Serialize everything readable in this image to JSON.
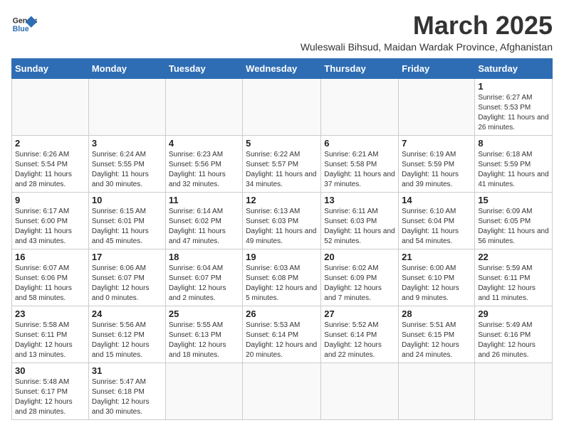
{
  "header": {
    "logo_general": "General",
    "logo_blue": "Blue",
    "month_title": "March 2025",
    "subtitle": "Wuleswali Bihsud, Maidan Wardak Province, Afghanistan"
  },
  "weekdays": [
    "Sunday",
    "Monday",
    "Tuesday",
    "Wednesday",
    "Thursday",
    "Friday",
    "Saturday"
  ],
  "weeks": [
    [
      {
        "num": "",
        "info": ""
      },
      {
        "num": "",
        "info": ""
      },
      {
        "num": "",
        "info": ""
      },
      {
        "num": "",
        "info": ""
      },
      {
        "num": "",
        "info": ""
      },
      {
        "num": "",
        "info": ""
      },
      {
        "num": "1",
        "info": "Sunrise: 6:27 AM\nSunset: 5:53 PM\nDaylight: 11 hours\nand 26 minutes."
      }
    ],
    [
      {
        "num": "2",
        "info": "Sunrise: 6:26 AM\nSunset: 5:54 PM\nDaylight: 11 hours\nand 28 minutes."
      },
      {
        "num": "3",
        "info": "Sunrise: 6:24 AM\nSunset: 5:55 PM\nDaylight: 11 hours\nand 30 minutes."
      },
      {
        "num": "4",
        "info": "Sunrise: 6:23 AM\nSunset: 5:56 PM\nDaylight: 11 hours\nand 32 minutes."
      },
      {
        "num": "5",
        "info": "Sunrise: 6:22 AM\nSunset: 5:57 PM\nDaylight: 11 hours\nand 34 minutes."
      },
      {
        "num": "6",
        "info": "Sunrise: 6:21 AM\nSunset: 5:58 PM\nDaylight: 11 hours\nand 37 minutes."
      },
      {
        "num": "7",
        "info": "Sunrise: 6:19 AM\nSunset: 5:59 PM\nDaylight: 11 hours\nand 39 minutes."
      },
      {
        "num": "8",
        "info": "Sunrise: 6:18 AM\nSunset: 5:59 PM\nDaylight: 11 hours\nand 41 minutes."
      }
    ],
    [
      {
        "num": "9",
        "info": "Sunrise: 6:17 AM\nSunset: 6:00 PM\nDaylight: 11 hours\nand 43 minutes."
      },
      {
        "num": "10",
        "info": "Sunrise: 6:15 AM\nSunset: 6:01 PM\nDaylight: 11 hours\nand 45 minutes."
      },
      {
        "num": "11",
        "info": "Sunrise: 6:14 AM\nSunset: 6:02 PM\nDaylight: 11 hours\nand 47 minutes."
      },
      {
        "num": "12",
        "info": "Sunrise: 6:13 AM\nSunset: 6:03 PM\nDaylight: 11 hours\nand 49 minutes."
      },
      {
        "num": "13",
        "info": "Sunrise: 6:11 AM\nSunset: 6:03 PM\nDaylight: 11 hours\nand 52 minutes."
      },
      {
        "num": "14",
        "info": "Sunrise: 6:10 AM\nSunset: 6:04 PM\nDaylight: 11 hours\nand 54 minutes."
      },
      {
        "num": "15",
        "info": "Sunrise: 6:09 AM\nSunset: 6:05 PM\nDaylight: 11 hours\nand 56 minutes."
      }
    ],
    [
      {
        "num": "16",
        "info": "Sunrise: 6:07 AM\nSunset: 6:06 PM\nDaylight: 11 hours\nand 58 minutes."
      },
      {
        "num": "17",
        "info": "Sunrise: 6:06 AM\nSunset: 6:07 PM\nDaylight: 12 hours\nand 0 minutes."
      },
      {
        "num": "18",
        "info": "Sunrise: 6:04 AM\nSunset: 6:07 PM\nDaylight: 12 hours\nand 2 minutes."
      },
      {
        "num": "19",
        "info": "Sunrise: 6:03 AM\nSunset: 6:08 PM\nDaylight: 12 hours\nand 5 minutes."
      },
      {
        "num": "20",
        "info": "Sunrise: 6:02 AM\nSunset: 6:09 PM\nDaylight: 12 hours\nand 7 minutes."
      },
      {
        "num": "21",
        "info": "Sunrise: 6:00 AM\nSunset: 6:10 PM\nDaylight: 12 hours\nand 9 minutes."
      },
      {
        "num": "22",
        "info": "Sunrise: 5:59 AM\nSunset: 6:11 PM\nDaylight: 12 hours\nand 11 minutes."
      }
    ],
    [
      {
        "num": "23",
        "info": "Sunrise: 5:58 AM\nSunset: 6:11 PM\nDaylight: 12 hours\nand 13 minutes."
      },
      {
        "num": "24",
        "info": "Sunrise: 5:56 AM\nSunset: 6:12 PM\nDaylight: 12 hours\nand 15 minutes."
      },
      {
        "num": "25",
        "info": "Sunrise: 5:55 AM\nSunset: 6:13 PM\nDaylight: 12 hours\nand 18 minutes."
      },
      {
        "num": "26",
        "info": "Sunrise: 5:53 AM\nSunset: 6:14 PM\nDaylight: 12 hours\nand 20 minutes."
      },
      {
        "num": "27",
        "info": "Sunrise: 5:52 AM\nSunset: 6:14 PM\nDaylight: 12 hours\nand 22 minutes."
      },
      {
        "num": "28",
        "info": "Sunrise: 5:51 AM\nSunset: 6:15 PM\nDaylight: 12 hours\nand 24 minutes."
      },
      {
        "num": "29",
        "info": "Sunrise: 5:49 AM\nSunset: 6:16 PM\nDaylight: 12 hours\nand 26 minutes."
      }
    ],
    [
      {
        "num": "30",
        "info": "Sunrise: 5:48 AM\nSunset: 6:17 PM\nDaylight: 12 hours\nand 28 minutes."
      },
      {
        "num": "31",
        "info": "Sunrise: 5:47 AM\nSunset: 6:18 PM\nDaylight: 12 hours\nand 30 minutes."
      },
      {
        "num": "",
        "info": ""
      },
      {
        "num": "",
        "info": ""
      },
      {
        "num": "",
        "info": ""
      },
      {
        "num": "",
        "info": ""
      },
      {
        "num": "",
        "info": ""
      }
    ]
  ]
}
